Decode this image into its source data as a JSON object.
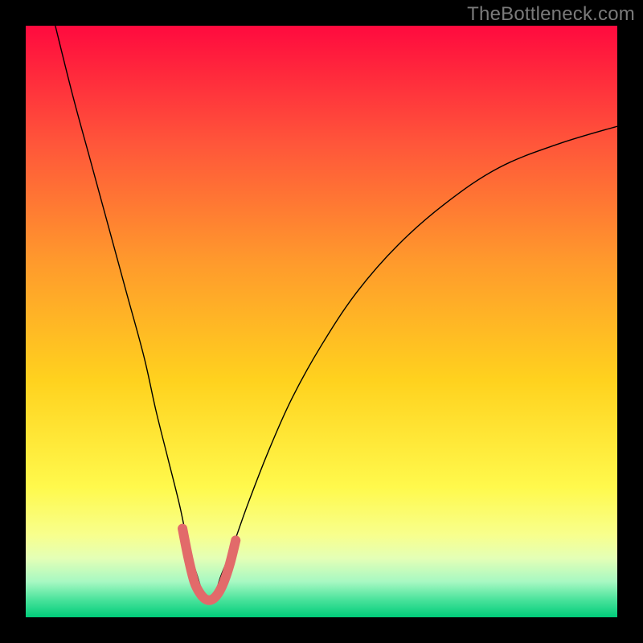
{
  "watermark": "TheBottleneck.com",
  "chart_data": {
    "type": "line",
    "title": "",
    "xlabel": "",
    "ylabel": "",
    "xlim": [
      0,
      100
    ],
    "ylim": [
      0,
      100
    ],
    "grid": false,
    "legend": false,
    "background_gradient": {
      "stops": [
        {
          "offset": 0.0,
          "color": "#ff0a3e"
        },
        {
          "offset": 0.2,
          "color": "#ff563a"
        },
        {
          "offset": 0.4,
          "color": "#ff9a2c"
        },
        {
          "offset": 0.6,
          "color": "#ffd21e"
        },
        {
          "offset": 0.78,
          "color": "#fff94c"
        },
        {
          "offset": 0.86,
          "color": "#f8ff8c"
        },
        {
          "offset": 0.9,
          "color": "#e4ffb6"
        },
        {
          "offset": 0.94,
          "color": "#a7f8c2"
        },
        {
          "offset": 0.97,
          "color": "#4be39c"
        },
        {
          "offset": 1.0,
          "color": "#00cc7a"
        }
      ]
    },
    "series": [
      {
        "name": "bottleneck-curve",
        "color": "#000000",
        "width": 1.4,
        "x": [
          5,
          8,
          11,
          14,
          17,
          20,
          22,
          24,
          26,
          27.5,
          29,
          30,
          31,
          32,
          33,
          35,
          37.5,
          41,
          45,
          50,
          56,
          63,
          71,
          80,
          90,
          100
        ],
        "y": [
          100,
          88,
          77,
          66,
          55,
          44,
          35,
          27,
          19,
          12,
          7,
          4,
          3,
          4,
          7,
          12,
          19,
          28,
          37,
          46,
          55,
          63,
          70,
          76,
          80,
          83
        ]
      },
      {
        "name": "optimal-zone-highlight",
        "color": "#e26a6a",
        "width": 12,
        "linecap": "round",
        "x": [
          26.5,
          27.5,
          28.5,
          29.5,
          30.5,
          31.5,
          32.5,
          33.5,
          34.5,
          35.5
        ],
        "y": [
          15,
          10,
          6,
          4,
          3,
          3,
          4,
          6,
          9,
          13
        ]
      }
    ]
  }
}
